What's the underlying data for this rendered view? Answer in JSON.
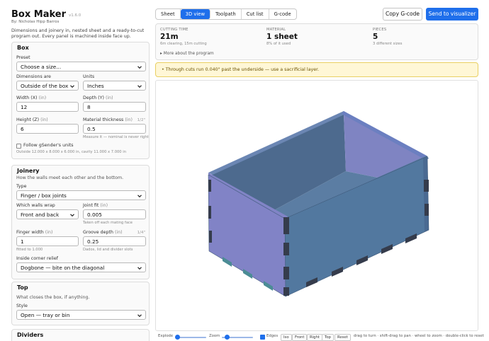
{
  "app": {
    "title": "Box Maker",
    "version": "v1.6.0",
    "author": "By: Nicholas Hipp Barros",
    "description": "Dimensions and joinery in, nested sheet and a ready-to-cut program out. Every panel is machined inside face up."
  },
  "box": {
    "title": "Box",
    "preset_label": "Preset",
    "preset_value": "Choose a size...",
    "dims_label": "Dimensions are",
    "dims_value": "Outside of the box",
    "units_label": "Units",
    "units_value": "Inches",
    "width_label": "Width (X)",
    "width_unit": "(in)",
    "width_value": "12",
    "depth_label": "Depth (Y)",
    "depth_unit": "(in)",
    "depth_value": "8",
    "height_label": "Height (Z)",
    "height_unit": "(in)",
    "height_value": "6",
    "thickness_label": "Material thickness",
    "thickness_unit": "(in)",
    "thickness_hint": "1/2\"",
    "thickness_value": "0.5",
    "thickness_help": "Measure it — nominal is never right",
    "follow_label": "Follow gSender's units",
    "summary": "Outside 12.000 x 8.000 x 6.000 in, cavity 11.000 x 7.000 in"
  },
  "joinery": {
    "title": "Joinery",
    "subtitle": "How the walls meet each other and the bottom.",
    "type_label": "Type",
    "type_value": "Finger / box joints",
    "wrap_label": "Which walls wrap",
    "wrap_value": "Front and back",
    "fit_label": "Joint fit",
    "fit_unit": "(in)",
    "fit_value": "0.005",
    "fit_help": "Taken off each mating face",
    "finger_label": "Finger width",
    "finger_unit": "(in)",
    "finger_value": "1",
    "finger_help": "fitted to 1.000",
    "groove_label": "Groove depth",
    "groove_unit": "(in)",
    "groove_hint": "1/4\"",
    "groove_value": "0.25",
    "groove_help": "Dados, lid and divider slots",
    "relief_label": "Inside corner relief",
    "relief_value": "Dogbone — bite on the diagonal"
  },
  "top": {
    "title": "Top",
    "subtitle": "What closes the box, if anything.",
    "style_label": "Style",
    "style_value": "Open — tray or bin"
  },
  "dividers": {
    "title": "Dividers"
  },
  "tabs": [
    {
      "label": "Sheet",
      "active": false
    },
    {
      "label": "3D view",
      "active": true
    },
    {
      "label": "Toolpath",
      "active": false
    },
    {
      "label": "Cut list",
      "active": false
    },
    {
      "label": "G-code",
      "active": false
    }
  ],
  "actions": {
    "copy_gcode": "Copy G-code",
    "send": "Send to visualizer"
  },
  "stats": {
    "cutting_label": "CUTTING TIME",
    "cutting_value": "21m",
    "cutting_sub": "6m clearing, 15m cutting",
    "material_label": "MATERIAL",
    "material_value": "1 sheet",
    "material_sub": "8% of it used",
    "pieces_label": "PIECES",
    "pieces_value": "5",
    "pieces_sub": "3 different sizes",
    "more": "More about the program"
  },
  "warning": "Through cuts run 0.040\" past the underside — use a sacrificial layer.",
  "viewer": {
    "explode_label": "Explode",
    "explode_level": 0.0,
    "zoom_label": "Zoom",
    "zoom_level": 0.1,
    "edges_label": "Edges",
    "edges_checked": true,
    "views": [
      "Iso",
      "Front",
      "Right",
      "Top",
      "Reset"
    ],
    "hint": "drag to turn · shift-drag to pan · wheel to zoom · double-click to reset"
  },
  "colors": {
    "accent": "#1f6feb",
    "face_front": "#8183c6",
    "face_side": "#52789f",
    "finger_dark": "#343c4c",
    "finger_teal": "#4b8c95",
    "warning_bg": "#fff7d6"
  },
  "icons": {
    "select": "chevron-down-icon",
    "more": "triangle-right-icon",
    "warning": "bullet-icon"
  }
}
